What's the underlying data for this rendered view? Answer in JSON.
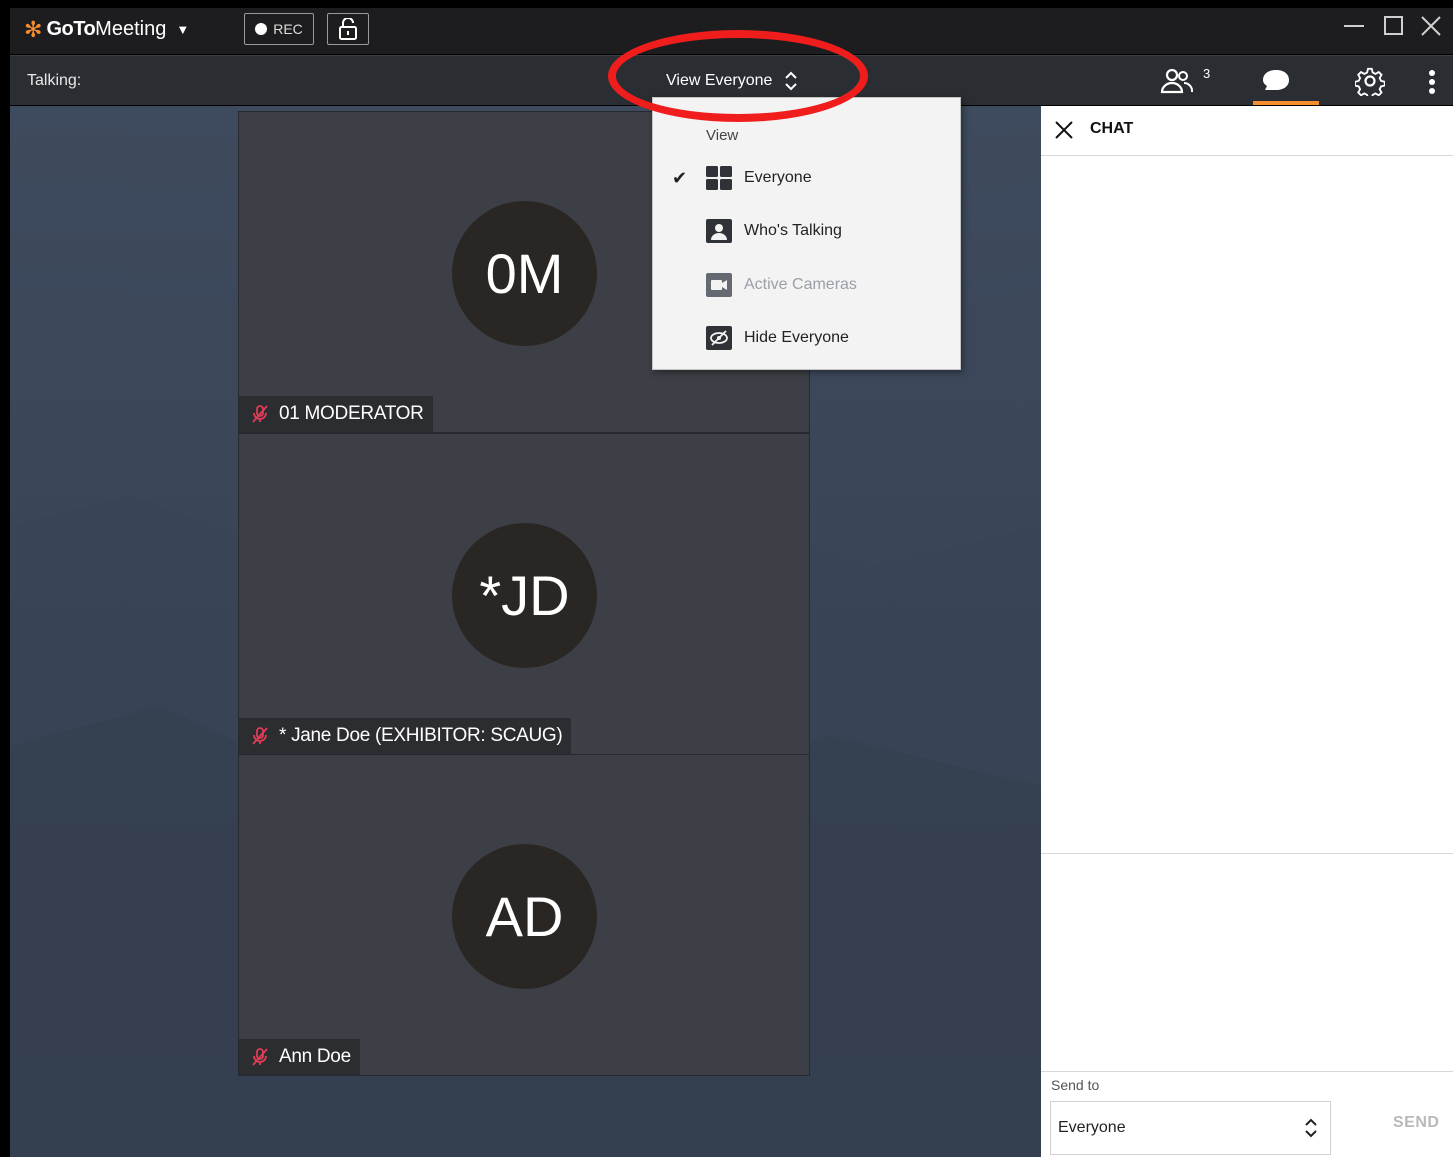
{
  "app": {
    "brand_bold": "GoTo",
    "brand_rest": "Meeting",
    "rec_label": "REC"
  },
  "toolbar": {
    "talking_label": "Talking:",
    "view_select_label": "View Everyone",
    "participant_count": "3"
  },
  "view_menu": {
    "header": "View",
    "items": [
      {
        "label": "Everyone",
        "icon": "grid-icon",
        "checked": true,
        "disabled": false
      },
      {
        "label": "Who's Talking",
        "icon": "person-icon",
        "checked": false,
        "disabled": false
      },
      {
        "label": "Active Cameras",
        "icon": "camera-icon",
        "checked": false,
        "disabled": true
      },
      {
        "label": "Hide Everyone",
        "icon": "eye-off-icon",
        "checked": false,
        "disabled": false
      }
    ]
  },
  "participants": [
    {
      "initials": "0M",
      "name": "01 MODERATOR",
      "muted": true
    },
    {
      "initials": "*JD",
      "name": "* Jane Doe (EXHIBITOR: SCAUG)",
      "muted": true
    },
    {
      "initials": "AD",
      "name": "Ann Doe",
      "muted": true
    }
  ],
  "chat": {
    "title": "CHAT",
    "send_to_label": "Send to",
    "send_to_value": "Everyone",
    "send_label": "SEND"
  },
  "colors": {
    "brand_orange": "#f68d2e",
    "highlight_red": "#f01d1d",
    "mute_red": "#e03c55"
  }
}
